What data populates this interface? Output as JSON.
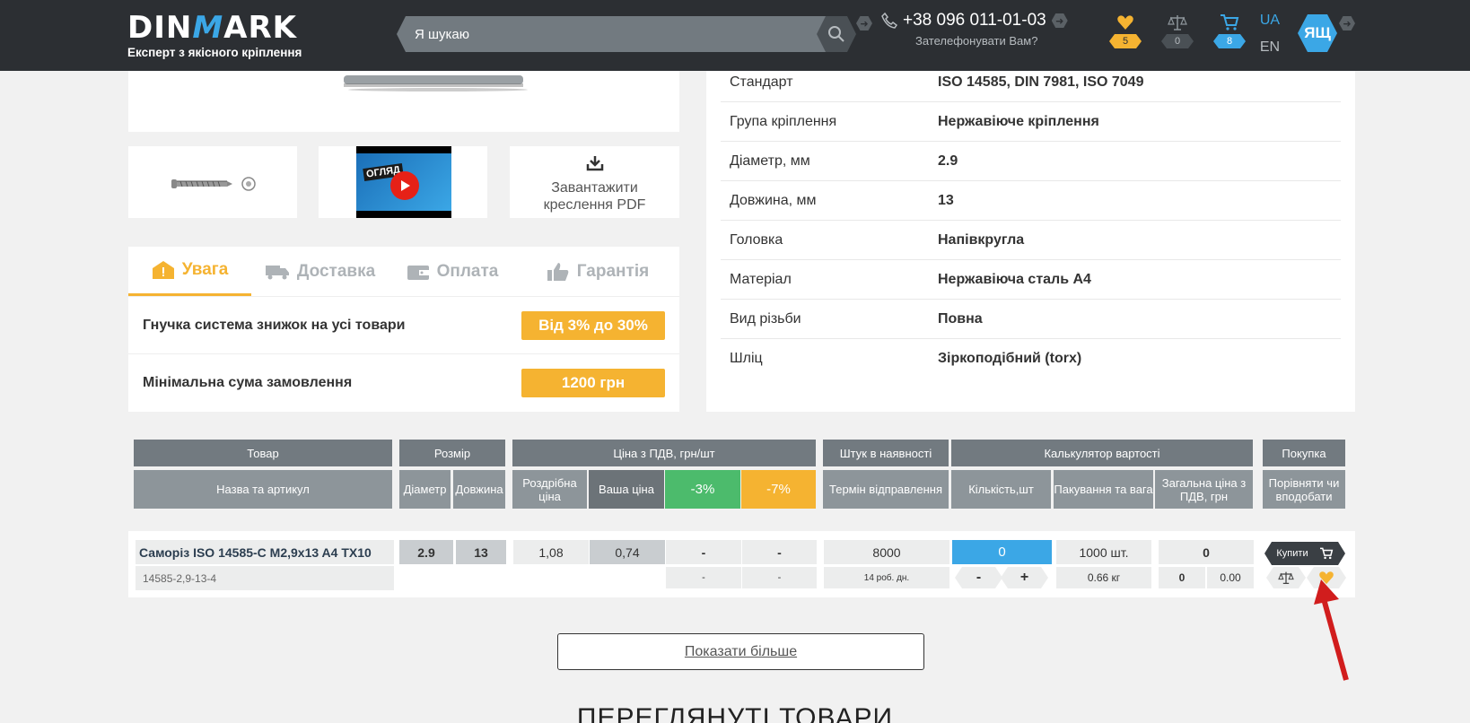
{
  "header": {
    "logo_word_a": "DIN",
    "logo_word_m": "M",
    "logo_word_b": "ARK",
    "logo_sub": "Експерт з якісного кріплення",
    "search_placeholder": "Я шукаю",
    "phone": "+38 096 011-01-03",
    "callback": "Зателефонувати Вам?",
    "favorites_count": "5",
    "compare_count": "0",
    "cart_count": "8",
    "lang_ua": "UA",
    "lang_en": "EN",
    "avatar": "ЯЩ",
    "colors": {
      "bg": "#2c2f33",
      "accent": "#3ba7e6",
      "yellow": "#f5b331"
    }
  },
  "media": {
    "video_title": "ОГЛЯД",
    "pdf_label_1": "Завантажити",
    "pdf_label_2": "креслення PDF"
  },
  "info": {
    "tabs": [
      {
        "label": "Увага",
        "icon": "warning-house-icon"
      },
      {
        "label": "Доставка",
        "icon": "truck-icon"
      },
      {
        "label": "Оплата",
        "icon": "wallet-icon"
      },
      {
        "label": "Гарантія",
        "icon": "thumbs-up-icon"
      }
    ],
    "rows": [
      {
        "text": "Гнучка система знижок на усі товари",
        "pill": "Від 3% до 30%"
      },
      {
        "text": "Мінімальна сума замовлення",
        "pill": "1200 грн"
      }
    ]
  },
  "specs": [
    {
      "k": "Стандарт",
      "v": "ISO 14585, DIN 7981, ISO 7049"
    },
    {
      "k": "Група кріплення",
      "v": "Нержавіюче кріплення"
    },
    {
      "k": "Діаметр, мм",
      "v": "2.9"
    },
    {
      "k": "Довжина, мм",
      "v": "13"
    },
    {
      "k": "Головка",
      "v": "Напівкругла"
    },
    {
      "k": "Матеріал",
      "v": "Нержавіюча сталь А4"
    },
    {
      "k": "Вид різьби",
      "v": "Повна"
    },
    {
      "k": "Шліц",
      "v": "Зіркоподібний (torx)"
    }
  ],
  "table": {
    "headers": {
      "product": "Товар",
      "size": "Розмір",
      "price": "Ціна з ПДВ, грн/шт",
      "stock": "Штук в наявності",
      "calc": "Калькулятор вартості",
      "purchase": "Покупка"
    },
    "subheaders": {
      "name": "Назва та артикул",
      "diameter": "Діаметр",
      "length": "Довжина",
      "retail": "Роздрібна ціна",
      "your_price": "Ваша ціна",
      "d3": "-3%",
      "d7": "-7%",
      "ship": "Термін відправлення",
      "qty": "Кількість,шт",
      "pack": "Пакування та вага",
      "total": "Загальна ціна з ПДВ, грн",
      "compare": "Порівняти чи вподобати"
    },
    "row": {
      "name": "Саморіз ISO 14585-C M2,9x13 A4 TX10",
      "sku": "14585-2,9-13-4",
      "diameter": "2.9",
      "length": "13",
      "retail": "1,08",
      "your_price": "0,74",
      "d3": "-",
      "d7": "-",
      "d3_sub": "-",
      "d7_sub": "-",
      "stock": "8000",
      "ship": "14 роб. дн.",
      "qty": "0",
      "minus": "-",
      "plus": "+",
      "pack": "1000 шт.",
      "weight": "0.66 кг",
      "total": "0",
      "total_a": "0",
      "total_b": "0.00",
      "buy": "Купити"
    }
  },
  "more_button": "Показати більше",
  "viewed_title": "ПЕРЕГЛЯНУТІ ТОВАРИ"
}
